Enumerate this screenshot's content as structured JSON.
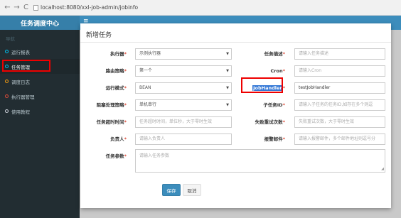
{
  "browser": {
    "back": "←",
    "forward": "→",
    "reload": "C",
    "url": "localhost:8080/xxl-job-admin/jobinfo"
  },
  "sidebar": {
    "brand": "任务调度中心",
    "header": "导航",
    "items": [
      {
        "label": "运行报表",
        "dot": "cyan"
      },
      {
        "label": "任务管理",
        "dot": "cyan"
      },
      {
        "label": "调度日志",
        "dot": "orange"
      },
      {
        "label": "执行器管理",
        "dot": "red"
      },
      {
        "label": "使用教程",
        "dot": "gray"
      }
    ]
  },
  "header": {
    "menu_icon": "≡"
  },
  "modal": {
    "title": "新增任务",
    "fields": {
      "executor": {
        "label": "执行器",
        "value": "示例执行器"
      },
      "desc": {
        "label": "任务描述",
        "placeholder": "请输入任务描述"
      },
      "route": {
        "label": "路由策略",
        "value": "第一个"
      },
      "cron": {
        "label": "Cron",
        "placeholder": "请输入Cron"
      },
      "glue": {
        "label": "运行模式",
        "value": "BEAN"
      },
      "handler": {
        "label": "JobHandler",
        "value": "testJobHandler"
      },
      "block": {
        "label": "阻塞处理策略",
        "value": "单机串行"
      },
      "child": {
        "label": "子任务ID",
        "placeholder": "请输入子任务的任务ID,如存在多个则逗"
      },
      "timeout": {
        "label": "任务超时时间",
        "placeholder": "任务超时时间，单位秒，大于零时生效"
      },
      "retry": {
        "label": "失败重试次数",
        "placeholder": "失败重试次数，大于零时生效"
      },
      "author": {
        "label": "负责人",
        "placeholder": "请输入负责人"
      },
      "email": {
        "label": "报警邮件",
        "placeholder": "请输入报警邮件，多个邮件地址则逗号分"
      },
      "param": {
        "label": "任务参数",
        "placeholder": "请输入任务参数"
      }
    },
    "save": "保存",
    "cancel": "取消"
  },
  "colors": {
    "brand": "#367fa9",
    "header": "#3c8dbc",
    "sidebar": "#222d32",
    "highlight": "#ee0000"
  }
}
